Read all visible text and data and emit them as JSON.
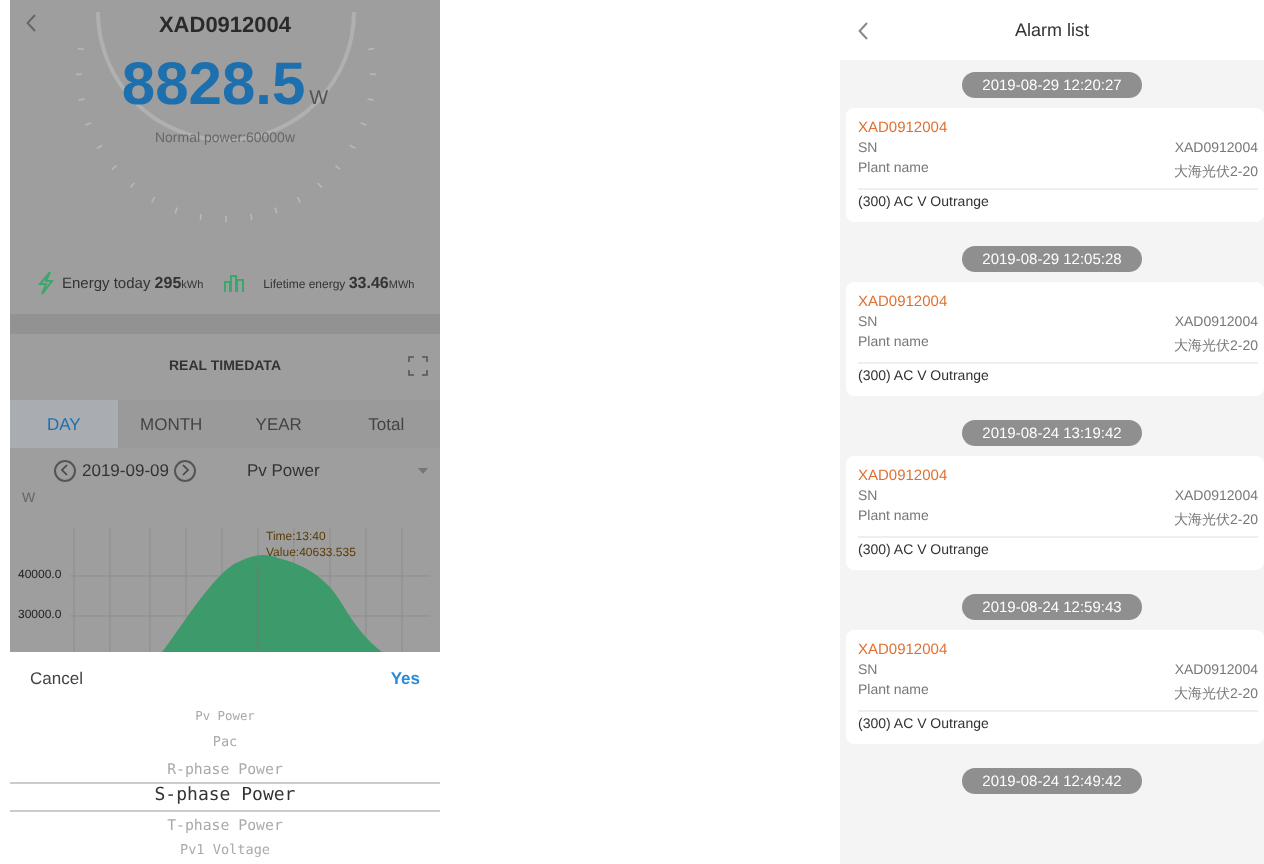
{
  "left": {
    "title": "XAD0912004",
    "power": {
      "value": "8828.5",
      "unit": "W"
    },
    "normal_power": "Normal power:60000w",
    "energy_today": {
      "label": "Energy today",
      "value": "295",
      "unit": "kWh"
    },
    "lifetime_energy": {
      "label": "Lifetime energy",
      "value": "33.46",
      "unit": "MWh"
    },
    "section_title": "REAL TIMEDATA",
    "tabs": [
      {
        "label": "DAY",
        "selected": true
      },
      {
        "label": "MONTH",
        "selected": false
      },
      {
        "label": "YEAR",
        "selected": false
      },
      {
        "label": "Total",
        "selected": false
      }
    ],
    "date": "2019-09-09",
    "parameter": "Pv Power",
    "y_unit": "W",
    "chart": {
      "yticks": [
        "40000.0",
        "30000.0"
      ],
      "tooltip_time": "Time:13:40",
      "tooltip_value": "Value:40633.535"
    },
    "picker": {
      "cancel": "Cancel",
      "confirm": "Yes",
      "options": [
        {
          "label": "Pv Power",
          "selected": false
        },
        {
          "label": "Pac",
          "selected": false
        },
        {
          "label": "R-phase Power",
          "selected": false
        },
        {
          "label": "S-phase Power",
          "selected": true
        },
        {
          "label": "T-phase Power",
          "selected": false
        },
        {
          "label": "Pv1 Voltage",
          "selected": false
        }
      ]
    }
  },
  "right": {
    "title": "Alarm list",
    "alarms": [
      {
        "time": "2019-08-29 12:20:27",
        "device": "XAD0912004",
        "sn_label": "SN",
        "sn": "XAD0912004",
        "plant_label": "Plant name",
        "plant": "大海光伏2-20",
        "message": "(300) AC V Outrange"
      },
      {
        "time": "2019-08-29 12:05:28",
        "device": "XAD0912004",
        "sn_label": "SN",
        "sn": "XAD0912004",
        "plant_label": "Plant name",
        "plant": "大海光伏2-20",
        "message": "(300) AC V Outrange"
      },
      {
        "time": "2019-08-24 13:19:42",
        "device": "XAD0912004",
        "sn_label": "SN",
        "sn": "XAD0912004",
        "plant_label": "Plant name",
        "plant": "大海光伏2-20",
        "message": "(300) AC V Outrange"
      },
      {
        "time": "2019-08-24 12:59:43",
        "device": "XAD0912004",
        "sn_label": "SN",
        "sn": "XAD0912004",
        "plant_label": "Plant name",
        "plant": "大海光伏2-20",
        "message": "(300) AC V Outrange"
      }
    ],
    "next_time": "2019-08-24 12:49:42"
  }
}
